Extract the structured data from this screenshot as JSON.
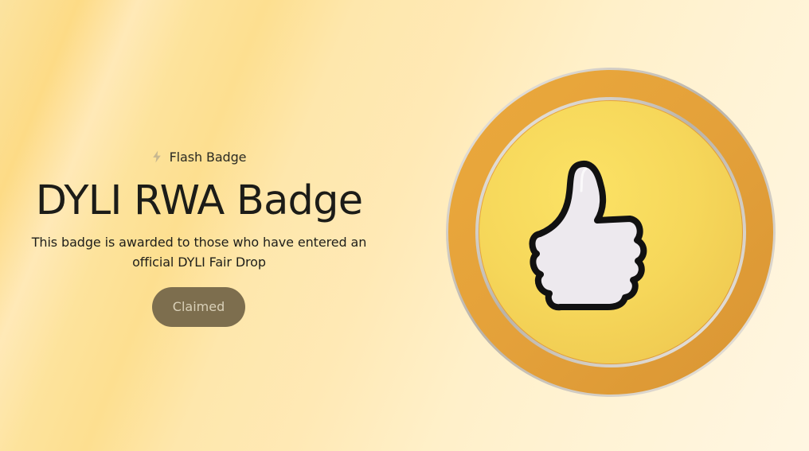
{
  "badge_type": {
    "label": "Flash Badge",
    "icon": "lightning-bolt-icon"
  },
  "title": "DYLI RWA Badge",
  "description": "This badge is awarded to those who have entered an official DYLI Fair Drop",
  "action": {
    "label": "Claimed"
  },
  "badge_image": {
    "icon": "thumbs-up-icon"
  },
  "colors": {
    "button_bg": "#7d6e4e",
    "button_text": "#d9d0b8",
    "badge_outer": "#e3a63a",
    "badge_inner": "#f6d75a",
    "thumb_fill": "#ede9ee"
  }
}
